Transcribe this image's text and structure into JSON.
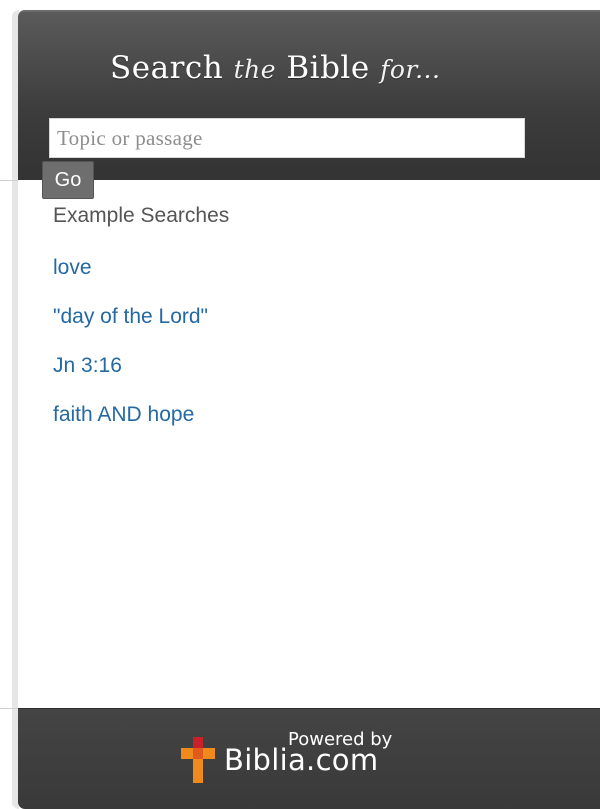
{
  "header": {
    "title_part1": "Search",
    "title_part2": "the",
    "title_part3": "Bible",
    "title_part4": "for..."
  },
  "search": {
    "placeholder": "Topic or passage",
    "value": "",
    "go_label": "Go"
  },
  "examples": {
    "heading": "Example Searches",
    "items": [
      {
        "label": "love"
      },
      {
        "label": "\"day of the Lord\""
      },
      {
        "label": "Jn 3:16"
      },
      {
        "label": "faith AND hope"
      }
    ]
  },
  "footer": {
    "powered_by": "Powered by",
    "brand": "Biblia.com",
    "logo_icon": "biblia-cross-icon"
  },
  "colors": {
    "header_bg": "#3c3c3c",
    "link": "#2469a3",
    "logo_orange": "#f08a1c",
    "logo_red": "#c9202a"
  }
}
